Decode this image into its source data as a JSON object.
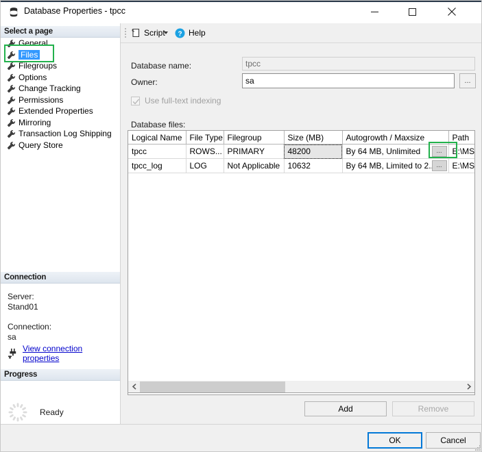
{
  "window": {
    "title": "Database Properties - tpcc",
    "icon": "database-icon",
    "controls": {
      "minimize": "minimize-icon",
      "maximize": "maximize-icon",
      "close": "close-icon"
    }
  },
  "sidebar": {
    "select_page_header": "Select a page",
    "pages": [
      {
        "label": "General",
        "icon": "wrench-icon",
        "selected": false
      },
      {
        "label": "Files",
        "icon": "wrench-icon",
        "selected": true
      },
      {
        "label": "Filegroups",
        "icon": "wrench-icon",
        "selected": false
      },
      {
        "label": "Options",
        "icon": "wrench-icon",
        "selected": false
      },
      {
        "label": "Change Tracking",
        "icon": "wrench-icon",
        "selected": false
      },
      {
        "label": "Permissions",
        "icon": "wrench-icon",
        "selected": false
      },
      {
        "label": "Extended Properties",
        "icon": "wrench-icon",
        "selected": false
      },
      {
        "label": "Mirroring",
        "icon": "wrench-icon",
        "selected": false
      },
      {
        "label": "Transaction Log Shipping",
        "icon": "wrench-icon",
        "selected": false
      },
      {
        "label": "Query Store",
        "icon": "wrench-icon",
        "selected": false
      }
    ],
    "connection": {
      "header": "Connection",
      "server_label": "Server:",
      "server_value": "Stand01",
      "connection_label": "Connection:",
      "connection_value": "sa",
      "link_text": "View connection properties",
      "link_icon": "plug-icon"
    },
    "progress": {
      "header": "Progress",
      "status": "Ready",
      "icon": "spinner-icon"
    }
  },
  "toolbar": {
    "script_label": "Script",
    "script_icon": "script-icon",
    "script_dropdown_icon": "chevron-down-icon",
    "help_label": "Help",
    "help_icon": "help-question-icon"
  },
  "main": {
    "database_name_label": "Database name:",
    "database_name_value": "tpcc",
    "owner_label": "Owner:",
    "owner_value": "sa",
    "owner_browse_label": "...",
    "fulltext_label": "Use full-text indexing",
    "fulltext_checked": true,
    "fulltext_enabled": false,
    "database_files_label": "Database files:",
    "grid": {
      "columns": [
        "Logical Name",
        "File Type",
        "Filegroup",
        "Size (MB)",
        "Autogrowth / Maxsize",
        "Path"
      ],
      "rows": [
        {
          "logical_name": "tpcc",
          "file_type": "ROWS...",
          "filegroup": "PRIMARY",
          "size_mb": "48200",
          "size_selected": true,
          "autogrowth": "By 64 MB, Unlimited",
          "autogrowth_btn": "...",
          "path": "E:\\MS"
        },
        {
          "logical_name": "tpcc_log",
          "file_type": "LOG",
          "filegroup": "Not Applicable",
          "size_mb": "10632",
          "size_selected": false,
          "autogrowth": "By 64 MB, Limited to 2...",
          "autogrowth_btn": "...",
          "path": "E:\\MS"
        }
      ]
    },
    "scrollbar": {
      "left_arrow_icon": "chevron-left-icon",
      "right_arrow_icon": "chevron-right-icon"
    },
    "add_label": "Add",
    "remove_label": "Remove",
    "remove_enabled": false
  },
  "footer": {
    "ok_label": "OK",
    "cancel_label": "Cancel"
  },
  "highlights": {
    "accent_color": "#22b14c",
    "selection_color": "#3399ff",
    "focus_color": "#0078d7",
    "targets": [
      "sidebar-item-files",
      "autogrowth-ellipsis-button-row-1"
    ]
  }
}
